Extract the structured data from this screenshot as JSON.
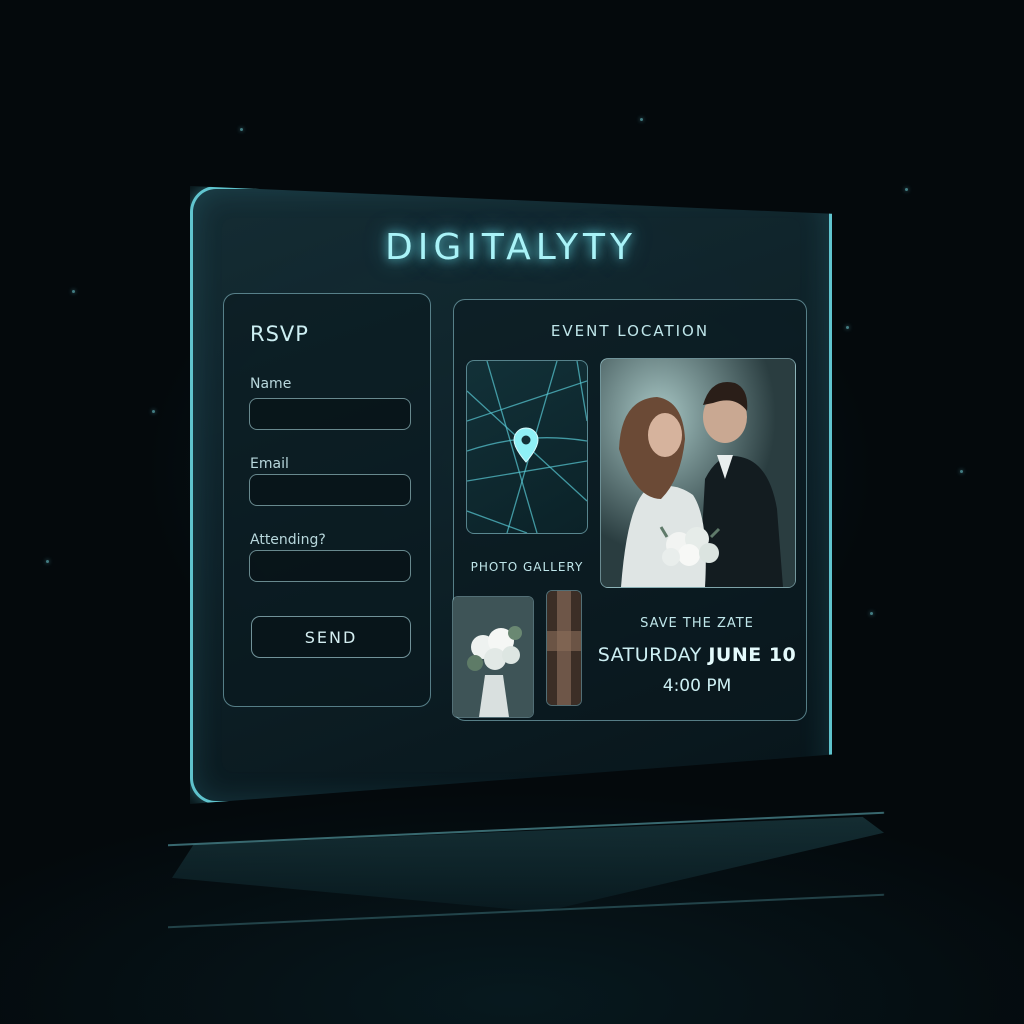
{
  "brand": {
    "title": "DIGITALYTY"
  },
  "rsvp": {
    "title": "RSVP",
    "fields": [
      {
        "label": "Name",
        "value": "",
        "placeholder": ""
      },
      {
        "label": "Email",
        "value": "",
        "placeholder": ""
      },
      {
        "label": "Attending?",
        "value": "",
        "placeholder": ""
      }
    ],
    "send_label": "SEND"
  },
  "event": {
    "location_heading": "EVENT LOCATION",
    "gallery_label": "PHOTO GALLERY",
    "save_label": "SAVE THE ZATE",
    "date_day": "SATURDAY",
    "date_month_day": "JUNE 10",
    "time": "4:00 PM"
  },
  "icons": {
    "map_pin": "map-pin-icon"
  },
  "colors": {
    "accent": "#6ee1eb",
    "background": "#04090c",
    "panel": "#16303a"
  }
}
